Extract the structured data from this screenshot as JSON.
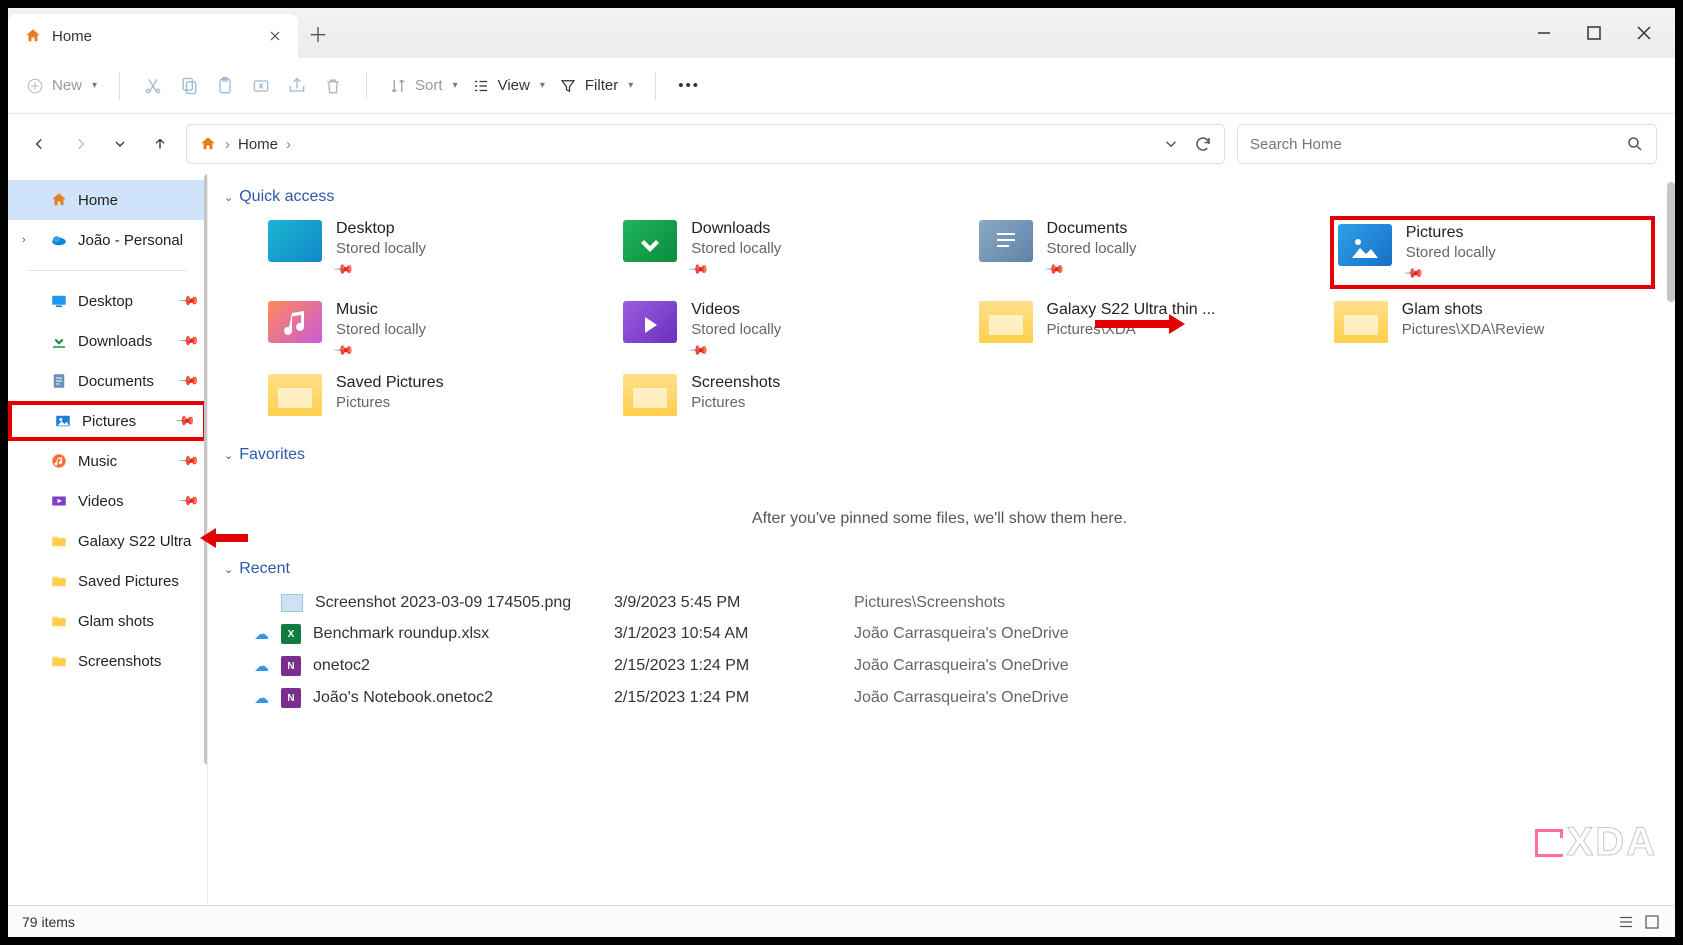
{
  "window": {
    "tab_title": "Home"
  },
  "toolbar": {
    "new": "New",
    "sort": "Sort",
    "view": "View",
    "filter": "Filter"
  },
  "address": {
    "root": "Home"
  },
  "search": {
    "placeholder": "Search Home"
  },
  "sidebar": [
    {
      "label": "Home",
      "icon": "home",
      "kind": "home"
    },
    {
      "label": "João - Personal",
      "icon": "onedrive",
      "expandable": true
    },
    {
      "sep": true
    },
    {
      "label": "Desktop",
      "icon": "desktop",
      "pinned": true
    },
    {
      "label": "Downloads",
      "icon": "downloads",
      "pinned": true
    },
    {
      "label": "Documents",
      "icon": "documents",
      "pinned": true
    },
    {
      "label": "Pictures",
      "icon": "pictures",
      "pinned": true,
      "highlight": true
    },
    {
      "label": "Music",
      "icon": "music",
      "pinned": true
    },
    {
      "label": "Videos",
      "icon": "videos",
      "pinned": true
    },
    {
      "label": "Galaxy S22 Ultra",
      "icon": "folder"
    },
    {
      "label": "Saved Pictures",
      "icon": "folder"
    },
    {
      "label": "Glam shots",
      "icon": "folder"
    },
    {
      "label": "Screenshots",
      "icon": "folder"
    }
  ],
  "sections": {
    "quick_access": "Quick access",
    "favorites": "Favorites",
    "recent": "Recent"
  },
  "favorites_empty": "After you've pinned some files, we'll show them here.",
  "quick_access": [
    {
      "name": "Desktop",
      "sub": "Stored locally",
      "pinned": true,
      "icon": "desktop-big"
    },
    {
      "name": "Downloads",
      "sub": "Stored locally",
      "pinned": true,
      "icon": "downloads-big"
    },
    {
      "name": "Documents",
      "sub": "Stored locally",
      "pinned": true,
      "icon": "documents-big"
    },
    {
      "name": "Pictures",
      "sub": "Stored locally",
      "pinned": true,
      "icon": "pictures-big",
      "highlight": true
    },
    {
      "name": "Music",
      "sub": "Stored locally",
      "pinned": true,
      "icon": "music-big"
    },
    {
      "name": "Videos",
      "sub": "Stored locally",
      "pinned": true,
      "icon": "videos-big"
    },
    {
      "name": "Galaxy S22 Ultra thin ...",
      "sub": "Pictures\\XDA",
      "icon": "folder-thumb"
    },
    {
      "name": "Glam shots",
      "sub": "Pictures\\XDA\\Review",
      "icon": "folder-thumb"
    },
    {
      "name": "Saved Pictures",
      "sub": "Pictures",
      "icon": "folder-thumb"
    },
    {
      "name": "Screenshots",
      "sub": "Pictures",
      "icon": "folder-thumb"
    }
  ],
  "recent": [
    {
      "name": "Screenshot 2023-03-09 174505.png",
      "date": "3/9/2023 5:45 PM",
      "loc": "Pictures\\Screenshots",
      "icon": "png",
      "cloud": false
    },
    {
      "name": "Benchmark roundup.xlsx",
      "date": "3/1/2023 10:54 AM",
      "loc": "João Carrasqueira's OneDrive",
      "icon": "xlsx",
      "cloud": true
    },
    {
      "name": "onetoc2",
      "date": "2/15/2023 1:24 PM",
      "loc": "João Carrasqueira's OneDrive",
      "icon": "onenote",
      "cloud": true
    },
    {
      "name": "João's Notebook.onetoc2",
      "date": "2/15/2023 1:24 PM",
      "loc": "João Carrasqueira's OneDrive",
      "icon": "onenote",
      "cloud": true
    }
  ],
  "status": {
    "count": "79 items"
  },
  "watermark": "XDA"
}
